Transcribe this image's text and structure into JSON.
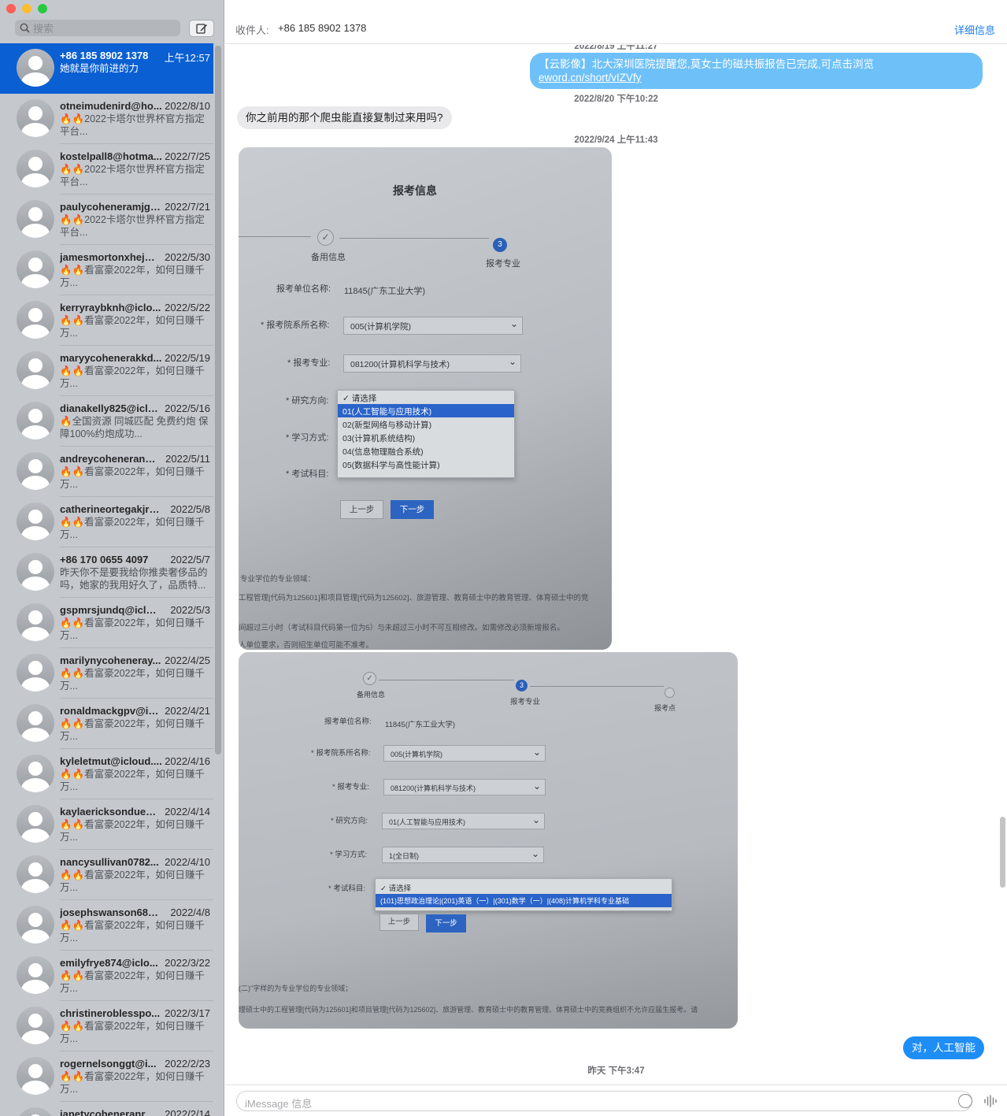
{
  "window": {
    "controls": {
      "close": "#fe5f57",
      "minimize": "#febc2e",
      "zoom": "#28c840"
    }
  },
  "sidebar": {
    "search_placeholder": "搜索",
    "conversations": [
      {
        "name": "+86 185 8902 1378",
        "date": "上午12:57",
        "preview": "她就是你前进的力",
        "selected": true
      },
      {
        "name": "otneimudenird@ho...",
        "date": "2022/8/10",
        "preview": "🔥🔥2022卡塔尔世界杯官方指定平台..."
      },
      {
        "name": "kostelpall8@hotma...",
        "date": "2022/7/25",
        "preview": "🔥🔥2022卡塔尔世界杯官方指定平台..."
      },
      {
        "name": "paulycoheneramjgs...",
        "date": "2022/7/21",
        "preview": "🔥🔥2022卡塔尔世界杯官方指定平台..."
      },
      {
        "name": "jamesmortonxhej@...",
        "date": "2022/5/30",
        "preview": "🔥🔥看富豪2022年，如何日赚千万..."
      },
      {
        "name": "kerryraybknh@iclo...",
        "date": "2022/5/22",
        "preview": "🔥🔥看富豪2022年，如何日赚千万..."
      },
      {
        "name": "maryycohenerakkd...",
        "date": "2022/5/19",
        "preview": "🔥🔥看富豪2022年，如何日赚千万..."
      },
      {
        "name": "dianakelly825@iclo...",
        "date": "2022/5/16",
        "preview": "🔥全国资源 同城匹配 免费约炮 保障100%约炮成功..."
      },
      {
        "name": "andreycoheneranwi...",
        "date": "2022/5/11",
        "preview": "🔥🔥看富豪2022年，如何日赚千万..."
      },
      {
        "name": "catherineortegakjra...",
        "date": "2022/5/8",
        "preview": "🔥🔥看富豪2022年，如何日赚千万..."
      },
      {
        "name": "+86 170 0655 4097",
        "date": "2022/5/7",
        "preview": "昨天你不是要我给你推卖奢侈品的吗，她家的我用好久了，品质特..."
      },
      {
        "name": "gspmrsjundq@iclou...",
        "date": "2022/5/3",
        "preview": "🔥🔥看富豪2022年，如何日赚千万..."
      },
      {
        "name": "marilynycoheneray...",
        "date": "2022/4/25",
        "preview": "🔥🔥看富豪2022年，如何日赚千万..."
      },
      {
        "name": "ronaldmackgpv@icl...",
        "date": "2022/4/21",
        "preview": "🔥🔥看富豪2022年，如何日赚千万..."
      },
      {
        "name": "kyleletmut@icloud....",
        "date": "2022/4/16",
        "preview": "🔥🔥看富豪2022年，如何日赚千万..."
      },
      {
        "name": "kaylaericksondue@...",
        "date": "2022/4/14",
        "preview": "🔥🔥看富豪2022年，如何日赚千万..."
      },
      {
        "name": "nancysullivan0782...",
        "date": "2022/4/10",
        "preview": "🔥🔥看富豪2022年，如何日赚千万..."
      },
      {
        "name": "josephswanson687...",
        "date": "2022/4/8",
        "preview": "🔥🔥看富豪2022年，如何日赚千万..."
      },
      {
        "name": "emilyfrye874@iclo...",
        "date": "2022/3/22",
        "preview": "🔥🔥看富豪2022年，如何日赚千万..."
      },
      {
        "name": "christineroblesspo...",
        "date": "2022/3/17",
        "preview": "🔥🔥看富豪2022年，如何日赚千万..."
      },
      {
        "name": "rogernelsonggt@i...",
        "date": "2022/2/23",
        "preview": "🔥🔥看富豪2022年，如何日赚千万..."
      },
      {
        "name": "janetycoheneranr@...",
        "date": "2022/2/14",
        "preview": ""
      }
    ]
  },
  "header": {
    "to_label": "收件人:",
    "to_value": "+86 185 8902 1378",
    "details": "详细信息"
  },
  "messages": {
    "ts0": "2022/8/19 上午11:27",
    "sms1_text": "【云影像】北大深圳医院提醒您,莫女士的磁共振报告已完成,可点击浏览 ",
    "sms1_link": "eword.cn/short/vIZVfy",
    "ts1": "2022/8/20 下午10:22",
    "in1": "你之前用的那个爬虫能直接复制过来用吗?",
    "ts2": "2022/9/24 上午11:43",
    "out1": "对，人工智能",
    "ts3": "昨天 下午3:47"
  },
  "photo1": {
    "title": "报考信息",
    "step_done": "备用信息",
    "step_num": "3",
    "step_cur": "报考专业",
    "unit_label": "报考单位名称:",
    "unit_value": "11845(广东工业大学)",
    "dept_label": "* 报考院系所名称:",
    "dept_value": "005(计算机学院)",
    "major_label": "* 报考专业:",
    "major_value": "081200(计算机科学与技术)",
    "dir_label": "* 研究方向:",
    "study_label": "* 学习方式:",
    "exam_label": "* 考试科目:",
    "options": [
      "✓ 请选择",
      "01(人工智能与应用技术)",
      "02(新型网络与移动计算)",
      "03(计算机系统结构)",
      "04(信息物理融合系统)",
      "05(数据科学与高性能计算)"
    ],
    "prev": "上一步",
    "next": "下一步",
    "note1": "专业学位的专业领域：",
    "note2": "工程管理[代码为125601]和项目管理[代码为125602]、旅游管理、教育硕士中的教育管理、体育硕士中的竞",
    "note3": "间超过三小时（考试科目代码第一位为5）与未超过三小时不可互相修改。如需修改必须新增报名。",
    "note4": "人单位要求，否则招生单位可能不准考。"
  },
  "photo2": {
    "step_done": "备用信息",
    "step_num": "3",
    "step_cur": "报考专业",
    "step_next": "报考点",
    "unit_label": "报考单位名称:",
    "unit_value": "11845(广东工业大学)",
    "dept_label": "* 报考院系所名称:",
    "dept_value": "005(计算机学院)",
    "major_label": "* 报考专业:",
    "major_value": "081200(计算机科学与技术)",
    "dir_label": "* 研究方向:",
    "dir_value": "01(人工智能与应用技术)",
    "study_label": "* 学习方式:",
    "study_value": "1(全日制)",
    "exam_label": "* 考试科目:",
    "options": [
      "✓ 请选择",
      "(101)思想政治理论|(201)英语（一）|(301)数学（一）|(408)计算机学科专业基础"
    ],
    "prev": "上一步",
    "next": "下一步",
    "note1": "(二)\"字样的为专业学位的专业领域；",
    "note2": "理硕士中的工程管理[代码为125601]和项目管理[代码为125602]、旅游管理、教育硕士中的教育管理、体育硕士中的竞赛组织不允许应届生报考。请"
  },
  "compose": {
    "placeholder": "iMessage 信息"
  }
}
